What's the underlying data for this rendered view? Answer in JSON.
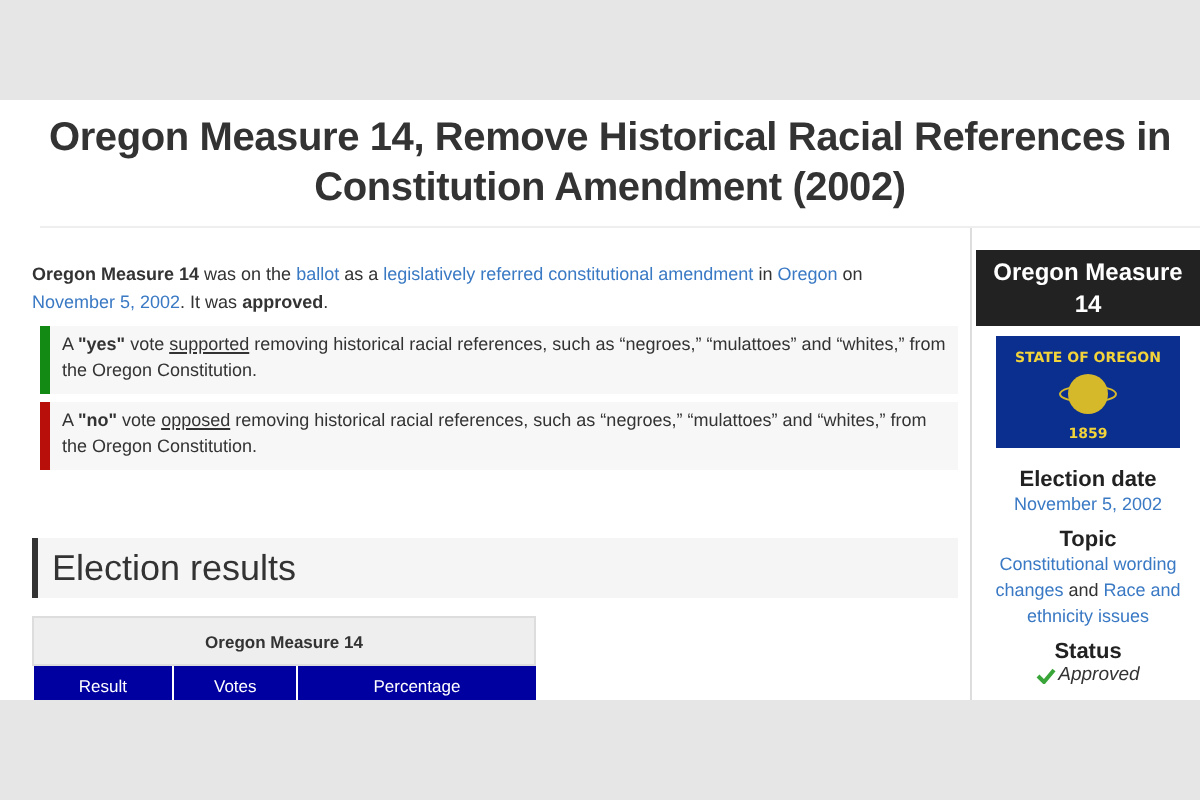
{
  "title": "Oregon Measure 14, Remove Historical Racial References in Constitution Amendment (2002)",
  "intro": [
    {
      "kind": "bold",
      "text": "Oregon Measure 14"
    },
    {
      "kind": "text",
      "text": " was on the "
    },
    {
      "kind": "link",
      "text": "ballot"
    },
    {
      "kind": "text",
      "text": " as a "
    },
    {
      "kind": "link",
      "text": "legislatively referred constitutional amendment"
    },
    {
      "kind": "text",
      "text": " in "
    },
    {
      "kind": "link",
      "text": "Oregon"
    },
    {
      "kind": "text",
      "text": " on "
    },
    {
      "kind": "link",
      "text": "November 5, 2002"
    },
    {
      "kind": "text",
      "text": ". It was "
    },
    {
      "kind": "bold",
      "text": "approved"
    },
    {
      "kind": "text",
      "text": "."
    }
  ],
  "votes": [
    {
      "color": "#138a13",
      "segments": [
        {
          "kind": "text",
          "text": "A "
        },
        {
          "kind": "bold",
          "text": "\"yes\""
        },
        {
          "kind": "text",
          "text": " vote "
        },
        {
          "kind": "underline",
          "text": "supported"
        },
        {
          "kind": "text",
          "text": " removing historical racial references, such as “negroes,” “mulattoes” and “whites,” from the Oregon Constitution."
        }
      ]
    },
    {
      "color": "#b80f0a",
      "segments": [
        {
          "kind": "text",
          "text": "A "
        },
        {
          "kind": "bold",
          "text": "\"no\""
        },
        {
          "kind": "text",
          "text": " vote "
        },
        {
          "kind": "underline",
          "text": "opposed"
        },
        {
          "kind": "text",
          "text": " removing historical racial references, such as “negroes,” “mulattoes” and “whites,” from the Oregon Constitution."
        }
      ]
    }
  ],
  "section_heading": "Election results",
  "table": {
    "caption": "Oregon Measure 14",
    "columns": [
      "Result",
      "Votes",
      "Percentage"
    ]
  },
  "infobox": {
    "title": "Oregon Measure 14",
    "flag": {
      "top_text": "STATE OF OREGON",
      "year": "1859"
    },
    "sections": [
      {
        "heading": "Election date",
        "kind": "links",
        "segments": [
          {
            "kind": "link",
            "text": "November 5, 2002"
          }
        ]
      },
      {
        "heading": "Topic",
        "kind": "links",
        "segments": [
          {
            "kind": "link",
            "text": "Constitutional wording changes"
          },
          {
            "kind": "text",
            "text": " and "
          },
          {
            "kind": "link",
            "text": "Race and ethnicity issues"
          }
        ]
      },
      {
        "heading": "Status",
        "kind": "status",
        "status": "Approved"
      }
    ]
  }
}
